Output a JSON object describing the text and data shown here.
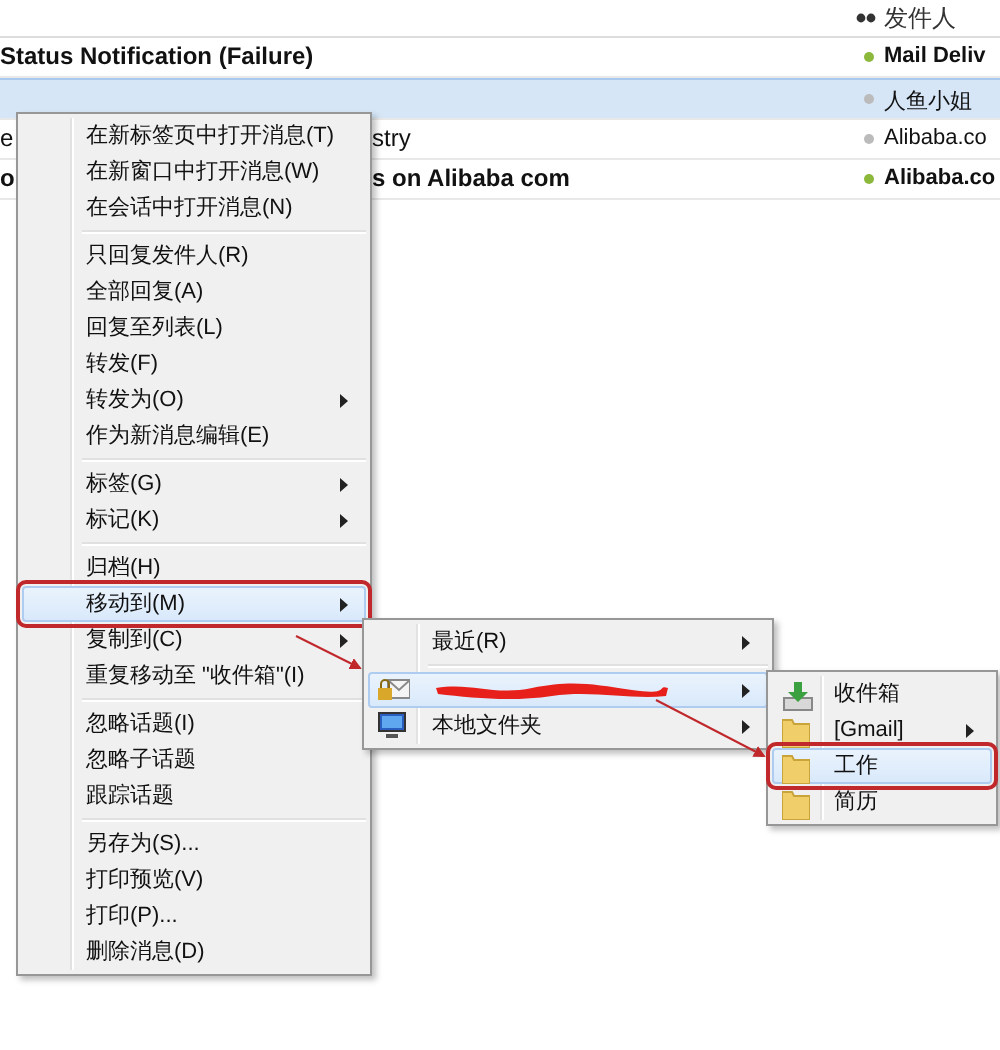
{
  "message_list": {
    "columns": [
      {
        "label": "发件人"
      }
    ],
    "rows": [
      {
        "subject_fragments": [
          "Status Notification (Failure)"
        ],
        "sender": "Mail Deliv",
        "unread": true,
        "selected": false
      },
      {
        "sender": "人鱼小姐",
        "unread": false,
        "selected": true
      },
      {
        "subject_fragments": [
          "e",
          "stry"
        ],
        "sender": "Alibaba.co",
        "unread": false,
        "selected": false
      },
      {
        "subject_fragments": [
          "o",
          "s on Alibaba com"
        ],
        "sender": "Alibaba.co",
        "unread": true,
        "selected": false
      }
    ]
  },
  "context_menu": {
    "groups": [
      [
        {
          "label": "在新标签页中打开消息(T)",
          "has_submenu": false,
          "selected": false,
          "annotated": false
        },
        {
          "label": "在新窗口中打开消息(W)",
          "has_submenu": false,
          "selected": false,
          "annotated": false
        },
        {
          "label": "在会话中打开消息(N)",
          "has_submenu": false,
          "selected": false,
          "annotated": false
        }
      ],
      [
        {
          "label": "只回复发件人(R)",
          "has_submenu": false,
          "selected": false,
          "annotated": false
        },
        {
          "label": "全部回复(A)",
          "has_submenu": false,
          "selected": false,
          "annotated": false
        },
        {
          "label": "回复至列表(L)",
          "has_submenu": false,
          "selected": false,
          "annotated": false
        },
        {
          "label": "转发(F)",
          "has_submenu": false,
          "selected": false,
          "annotated": false
        },
        {
          "label": "转发为(O)",
          "has_submenu": true,
          "selected": false,
          "annotated": false
        },
        {
          "label": "作为新消息编辑(E)",
          "has_submenu": false,
          "selected": false,
          "annotated": false
        }
      ],
      [
        {
          "label": "标签(G)",
          "has_submenu": true,
          "selected": false,
          "annotated": false
        },
        {
          "label": "标记(K)",
          "has_submenu": true,
          "selected": false,
          "annotated": false
        }
      ],
      [
        {
          "label": "归档(H)",
          "has_submenu": false,
          "selected": false,
          "annotated": false
        },
        {
          "label": "移动到(M)",
          "has_submenu": true,
          "selected": true,
          "annotated": true
        },
        {
          "label": "复制到(C)",
          "has_submenu": true,
          "selected": false,
          "annotated": false
        },
        {
          "label": "重复移动至 \"收件箱\"(I)",
          "has_submenu": false,
          "selected": false,
          "annotated": false
        }
      ],
      [
        {
          "label": "忽略话题(I)",
          "has_submenu": false,
          "selected": false,
          "annotated": false
        },
        {
          "label": "忽略子话题",
          "has_submenu": false,
          "selected": false,
          "annotated": false
        },
        {
          "label": "跟踪话题",
          "has_submenu": false,
          "selected": false,
          "annotated": false
        }
      ],
      [
        {
          "label": "另存为(S)...",
          "has_submenu": false,
          "selected": false,
          "annotated": false
        },
        {
          "label": "打印预览(V)",
          "has_submenu": false,
          "selected": false,
          "annotated": false
        },
        {
          "label": "打印(P)...",
          "has_submenu": false,
          "selected": false,
          "annotated": false
        },
        {
          "label": "删除消息(D)",
          "has_submenu": false,
          "selected": false,
          "annotated": false
        }
      ]
    ]
  },
  "move_submenu": {
    "groups": [
      [
        {
          "kind": "plain",
          "label": "最近(R)",
          "has_submenu": true,
          "selected": false
        }
      ],
      [
        {
          "kind": "account",
          "has_submenu": true,
          "selected": true
        },
        {
          "kind": "local-folders",
          "label": "本地文件夹",
          "has_submenu": true,
          "selected": false
        }
      ]
    ]
  },
  "folder_submenu": {
    "items": [
      {
        "kind": "inbox",
        "label": "收件箱",
        "has_submenu": false,
        "selected": false,
        "annotated": false
      },
      {
        "kind": "folder",
        "label": "[Gmail]",
        "has_submenu": true,
        "selected": false,
        "annotated": false
      },
      {
        "kind": "folder",
        "label": "工作",
        "has_submenu": false,
        "selected": true,
        "annotated": true
      },
      {
        "kind": "folder",
        "label": "简历",
        "has_submenu": false,
        "selected": false,
        "annotated": false
      }
    ]
  }
}
